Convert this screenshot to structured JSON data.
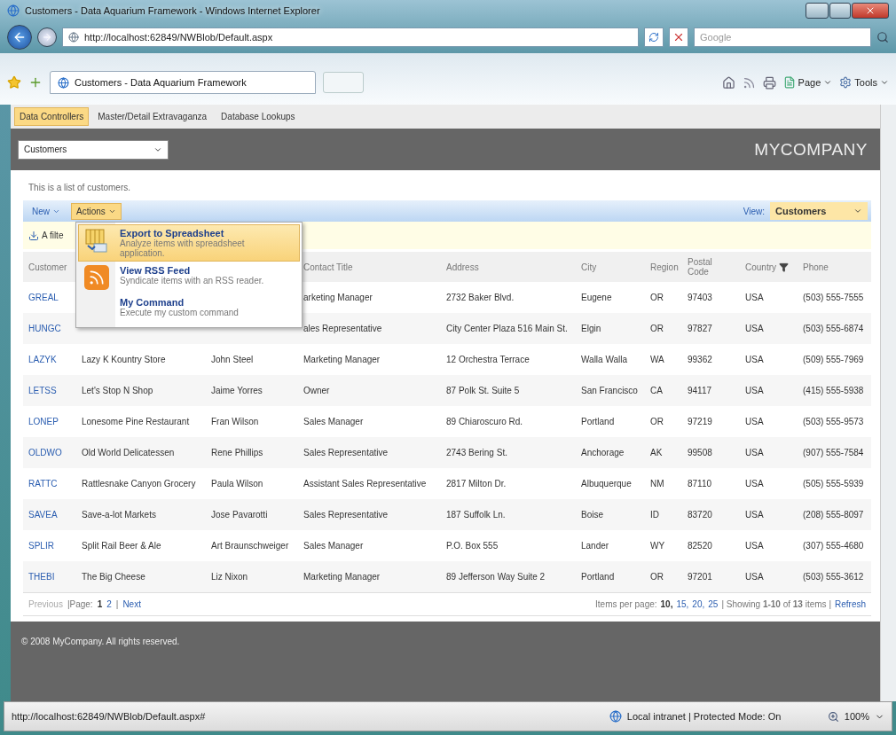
{
  "window": {
    "title": "Customers - Data Aquarium Framework - Windows Internet Explorer"
  },
  "address_bar": {
    "url": "http://localhost:62849/NWBlob/Default.aspx"
  },
  "search_field": {
    "placeholder": "Google"
  },
  "browser_tab": {
    "title": "Customers - Data Aquarium Framework"
  },
  "command_bar": [
    {
      "kind": "page",
      "label": "Page"
    },
    {
      "kind": "tools",
      "label": "Tools"
    }
  ],
  "page": {
    "tabs": [
      {
        "label": "Data Controllers",
        "selected": true
      },
      {
        "label": "Master/Detail Extravaganza",
        "selected": false
      },
      {
        "label": "Database Lookups",
        "selected": false
      }
    ],
    "controller_select": "Customers",
    "brand": "MYCOMPANY",
    "description": "This is a list of customers.",
    "action_bar": {
      "menus": [
        {
          "label": "New",
          "selected": false
        },
        {
          "label": "Actions",
          "selected": true
        }
      ],
      "view_label": "View:",
      "view_value": "Customers"
    },
    "filter_text": "A filte",
    "action_menu": [
      {
        "kind": "spreadsheet",
        "title": "Export to Spreadsheet",
        "description": "Analyze items with spreadsheet application.",
        "selected": true
      },
      {
        "kind": "rss",
        "title": "View RSS Feed",
        "description": "Syndicate items with an RSS reader.",
        "selected": false
      },
      {
        "kind": "plain",
        "title": "My Command",
        "description": "Execute my custom command",
        "selected": false
      }
    ],
    "table": {
      "columns": [
        {
          "label": "Customer"
        },
        null,
        null,
        {
          "label": "Contact Title"
        },
        {
          "label": "Address"
        },
        {
          "label": "City"
        },
        {
          "label": "Region"
        },
        {
          "label": "Postal Code"
        },
        {
          "label": "Country",
          "filtered": true
        },
        {
          "label": "Phone"
        }
      ],
      "rows": [
        [
          "GREAL",
          null,
          null,
          "arketing Manager",
          "2732 Baker Blvd.",
          "Eugene",
          "OR",
          "97403",
          "USA",
          "(503) 555-7555"
        ],
        [
          "HUNGC",
          null,
          null,
          "ales Representative",
          "City Center Plaza 516 Main St.",
          "Elgin",
          "OR",
          "97827",
          "USA",
          "(503) 555-6874"
        ],
        [
          "LAZYK",
          "Lazy K Kountry Store",
          "John Steel",
          "Marketing Manager",
          "12 Orchestra Terrace",
          "Walla Walla",
          "WA",
          "99362",
          "USA",
          "(509) 555-7969"
        ],
        [
          "LETSS",
          "Let's Stop N Shop",
          "Jaime Yorres",
          "Owner",
          "87 Polk St. Suite 5",
          "San Francisco",
          "CA",
          "94117",
          "USA",
          "(415) 555-5938"
        ],
        [
          "LONEP",
          "Lonesome Pine Restaurant",
          "Fran Wilson",
          "Sales Manager",
          "89 Chiaroscuro Rd.",
          "Portland",
          "OR",
          "97219",
          "USA",
          "(503) 555-9573"
        ],
        [
          "OLDWO",
          "Old World Delicatessen",
          "Rene Phillips",
          "Sales Representative",
          "2743 Bering St.",
          "Anchorage",
          "AK",
          "99508",
          "USA",
          "(907) 555-7584"
        ],
        [
          "RATTC",
          "Rattlesnake Canyon Grocery",
          "Paula Wilson",
          "Assistant Sales Representative",
          "2817 Milton Dr.",
          "Albuquerque",
          "NM",
          "87110",
          "USA",
          "(505) 555-5939"
        ],
        [
          "SAVEA",
          "Save-a-lot Markets",
          "Jose Pavarotti",
          "Sales Representative",
          "187 Suffolk Ln.",
          "Boise",
          "ID",
          "83720",
          "USA",
          "(208) 555-8097"
        ],
        [
          "SPLIR",
          "Split Rail Beer & Ale",
          "Art Braunschweiger",
          "Sales Manager",
          "P.O. Box 555",
          "Lander",
          "WY",
          "82520",
          "USA",
          "(307) 555-4680"
        ],
        [
          "THEBI",
          "The Big Cheese",
          "Liz Nixon",
          "Marketing Manager",
          "89 Jefferson Way Suite 2",
          "Portland",
          "OR",
          "97201",
          "USA",
          "(503) 555-3612"
        ]
      ]
    },
    "pager": {
      "previous": {
        "label": "Previous",
        "disabled": true
      },
      "page_label": "|Page:",
      "pages": [
        {
          "label": "1",
          "selected": true
        },
        {
          "label": "2",
          "selected": false
        }
      ],
      "separator": "|",
      "next": {
        "label": "Next",
        "disabled": false
      },
      "sizes_label": "Items per page:",
      "sizes": [
        {
          "label": "10,",
          "selected": true
        },
        {
          "label": "15,",
          "selected": false
        },
        {
          "label": "20,",
          "selected": false
        },
        {
          "label": "25",
          "selected": false
        }
      ],
      "summary": "| Showing **1-10** of **13** items |",
      "refresh": "Refresh"
    },
    "footer": "© 2008 MyCompany. All rights reserved."
  },
  "status_bar": {
    "url": "http://localhost:62849/NWBlob/Default.aspx#",
    "zone": "Local intranet | Protected Mode: On",
    "zoom": "100%"
  }
}
